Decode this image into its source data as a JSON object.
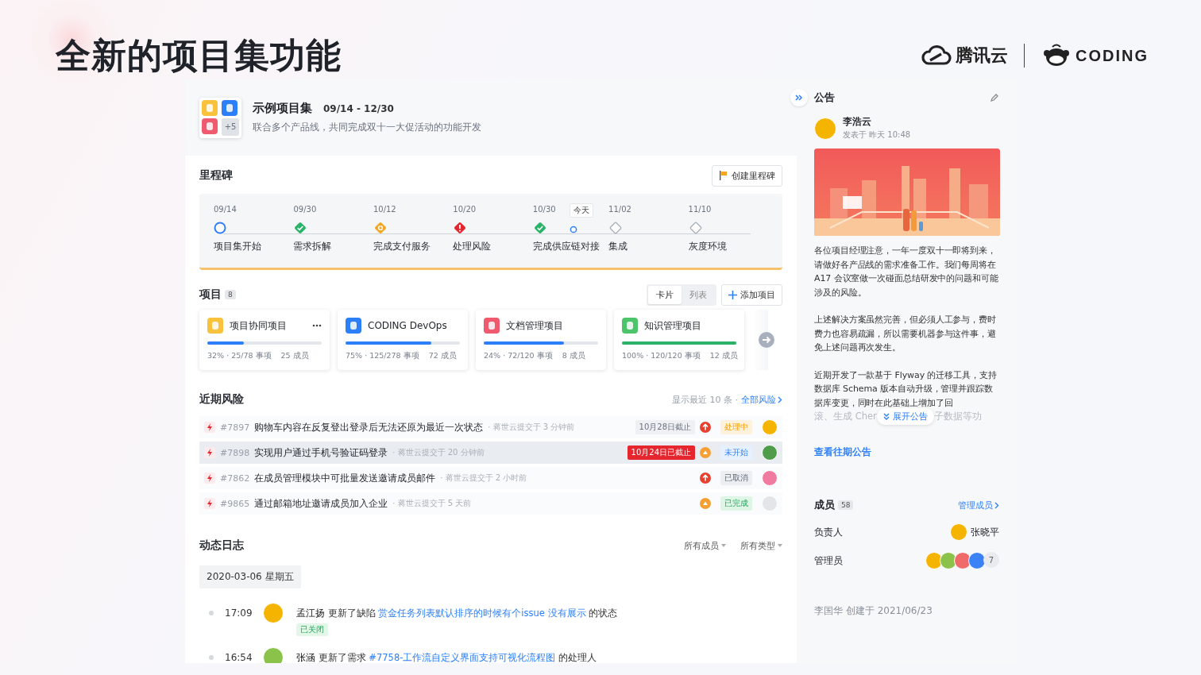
{
  "slide": {
    "title": "全新的项目集功能",
    "logos": [
      {
        "kind": "tencent",
        "text": "腾讯云"
      },
      {
        "kind": "coding",
        "text": "CODING"
      }
    ]
  },
  "header": {
    "icons": [
      {
        "color": "#f9c23c"
      },
      {
        "color": "#2d7ff9"
      },
      {
        "color": "#ef5a6f"
      }
    ],
    "more": "+5",
    "name": "示例项目集",
    "dates": "09/14 - 12/30",
    "description": "联合多个产品线，共同完成双十一大促活动的功能开发"
  },
  "milestones": {
    "title": "里程碑",
    "create_button": "创建里程碑",
    "items": [
      {
        "date": "09/14",
        "label": "项目集开始",
        "kind": "start"
      },
      {
        "date": "09/30",
        "label": "需求拆解",
        "kind": "done"
      },
      {
        "date": "10/12",
        "label": "完成支付服务",
        "kind": "progress"
      },
      {
        "date": "10/20",
        "label": "处理风险",
        "kind": "risk"
      },
      {
        "date": "10/30",
        "label": "完成供应链对接",
        "kind": "done"
      },
      {
        "tag": "今天",
        "kind": "today"
      },
      {
        "date": "11/02",
        "label": "集成",
        "kind": "pending"
      },
      {
        "date": "11/10",
        "label": "灰度环境",
        "kind": "pending"
      }
    ]
  },
  "projects": {
    "title": "项目",
    "count": "8",
    "views": [
      {
        "label": "卡片",
        "selected": true
      },
      {
        "label": "列表",
        "selected": false
      }
    ],
    "add_button": "添加项目",
    "cards": [
      {
        "name": "项目协同项目",
        "color": "#f9c23c",
        "level": 0.32,
        "stats": "32% · 25/78 事项",
        "members": "25 成员",
        "menu": true
      },
      {
        "name": "CODING DevOps",
        "color": "#2d7ff9",
        "level": 0.75,
        "stats": "75% · 125/278 事项",
        "members": "72 成员",
        "menu": false
      },
      {
        "name": "文档管理项目",
        "color": "#ef5a6f",
        "level": 0.7,
        "stats": "24% · 72/120 事项",
        "members": "8 成员",
        "menu": false
      },
      {
        "name": "知识管理项目",
        "color": "#4cc46a",
        "level": 1,
        "stats": "100% · 120/120 事项",
        "members": "12 成员",
        "menu": false
      }
    ]
  },
  "risks": {
    "title": "近期风险",
    "summary": "显示最近 10 条 ·",
    "all_link": "全部风险",
    "rows": [
      {
        "id": "#7897",
        "title": "购物车内容在反复登出登录后无法还原为最近一次状态",
        "meta": "· 蒋世云提交于 3 分钟前",
        "deadline": "10月28日截止",
        "overdue": false,
        "priority": {
          "kind": "high"
        },
        "status": {
          "text": "处理中",
          "kind": "processing"
        },
        "avatar": {
          "color": "#f5b400"
        },
        "selected": false
      },
      {
        "id": "#7898",
        "title": "实现用户通过手机号验证码登录",
        "meta": "· 蒋世云提交于 20 分钟前",
        "deadline": "10月24日已截止",
        "overdue": true,
        "priority": {
          "kind": "medium"
        },
        "status": {
          "text": "未开始",
          "kind": "todo"
        },
        "avatar": {
          "color": "#4f9d4a"
        },
        "selected": true
      },
      {
        "id": "#7862",
        "title": "在成员管理模块中可批量发送邀请成员邮件",
        "meta": "· 蒋世云提交于 2 小时前",
        "priority": {
          "kind": "high"
        },
        "status": {
          "text": "已取消",
          "kind": "cancelled"
        },
        "avatar": {
          "color": "#f07aa0"
        },
        "selected": false
      },
      {
        "id": "#9865",
        "title": "通过邮箱地址邀请成员加入企业",
        "meta": "· 蒋世云提交于 5 天前",
        "priority": {
          "kind": "medium"
        },
        "status": {
          "text": "已完成",
          "kind": "done"
        },
        "avatar": {
          "color": "#e3e5e8"
        },
        "selected": false
      }
    ]
  },
  "log": {
    "title": "动态日志",
    "filters": [
      "所有成员",
      "所有类型"
    ],
    "date": "2020-03-06 星期五",
    "entries": [
      {
        "time": "17:09",
        "avatar": {
          "color": "#f5b400"
        },
        "user": "孟江扬",
        "action": "更新了缺陷",
        "link": "赏金任务列表默认排序的时候有个issue 没有展示",
        "suffix": "的状态",
        "tag": "已关闭"
      },
      {
        "time": "16:54",
        "avatar": {
          "color": "#8bc34a"
        },
        "user": "张涵",
        "action": "更新了需求",
        "link": "#7758-工作流自定义界面支持可视化流程图",
        "suffix": "的处理人"
      }
    ]
  },
  "announcement": {
    "title": "公告",
    "author": "李浩云",
    "posted": "发表于 昨天 10:48",
    "author_avatar": {
      "color": "#f5b400"
    },
    "picture": {
      "kind": "picture"
    },
    "paragraphs": [
      "各位项目经理注意，一年一度双十一即将到来，请做好各产品线的需求准备工作。我们每周将在 A17 会议室做一次碰面总结研发中的问题和可能涉及的风险。",
      "上述解决方案虽然完善，但必须人工参与，费时费力也容易疏漏，所以需要机器参与这件事，避免上述问题再次发生。",
      "近期开发了一款基于 Flyway 的迁移工具，支持数据库 Schema 版本自动升级，管理并跟踪数据库变更，同时在此基础上增加了回"
    ],
    "faded_left": "滚、生成 Cher",
    "faded_right": "子数据等功",
    "expand_button": "展开公告",
    "history_link": "查看往期公告"
  },
  "members": {
    "title": "成员",
    "count": "58",
    "manage_link": "管理成员",
    "owner_label": "负责人",
    "owner": {
      "name": "张晓平",
      "avatar": {
        "color": "#f5b400"
      }
    },
    "admin_label": "管理员",
    "admins": [
      {
        "color": "#f5b400"
      },
      {
        "color": "#8bc34a"
      },
      {
        "color": "#f06a6a"
      },
      {
        "color": "#3b82f6"
      }
    ],
    "admin_more": "7",
    "footer": "李国华 创建于 2021/06/23"
  }
}
